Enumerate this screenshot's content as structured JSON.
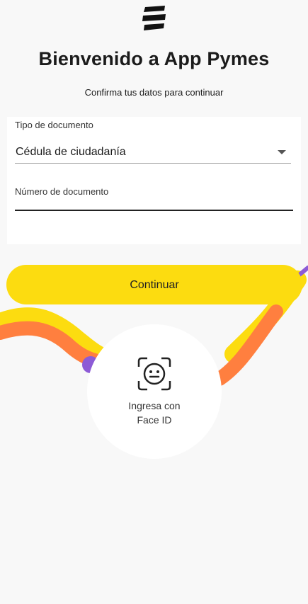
{
  "header": {
    "title": "Bienvenido a App Pymes",
    "subtitle": "Confirma tus datos para continuar"
  },
  "form": {
    "doc_type_label": "Tipo de documento",
    "doc_type_value": "Cédula de ciudadanía",
    "doc_number_label": "Número de documento",
    "doc_number_value": ""
  },
  "actions": {
    "continue_label": "Continuar",
    "face_id_line1": "Ingresa con",
    "face_id_line2": "Face ID"
  },
  "colors": {
    "primary_yellow": "#fcdc10",
    "wave_orange": "#ff7f3f",
    "wave_purple": "#8d5bd6",
    "background": "#f8f8f8"
  },
  "icons": {
    "logo": "stacked-bars-logo-icon",
    "face_id": "face-scan-icon",
    "select_arrow": "caret-down-icon"
  }
}
